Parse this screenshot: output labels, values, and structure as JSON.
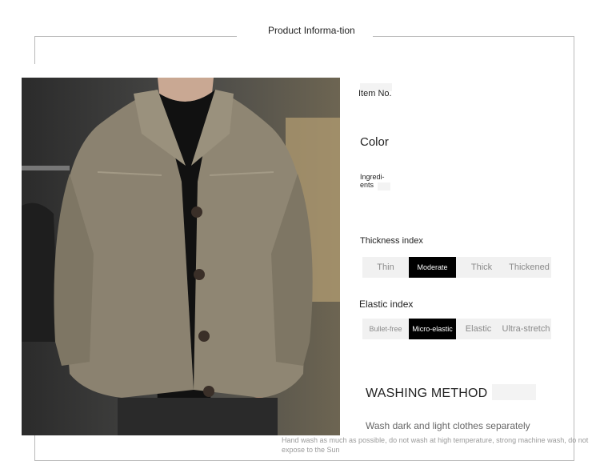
{
  "header": {
    "title": "Product Informa-tion"
  },
  "product": {
    "image_name": "fleece-jacket-photo"
  },
  "details": {
    "item_no_label": "Item No.",
    "color_label": "Color",
    "ingredients_label": "Ingredi-ents"
  },
  "thickness": {
    "label": "Thickness index",
    "options": [
      "Thin",
      "Moderate",
      "Thick",
      "Thickened"
    ],
    "selected": "Moderate"
  },
  "elasticity": {
    "label": "Elastic index",
    "options": [
      "Bullet-free",
      "Micro-elastic",
      "Elastic",
      "Ultra-stretch"
    ],
    "selected": "Micro-elastic"
  },
  "washing": {
    "title": "WASHING METHOD",
    "subtitle": "Wash dark and light clothes separately",
    "note": "Hand wash as much as possible, do not wash at high temperature, strong machine wash, do not expose to the Sun"
  },
  "colors": {
    "frame": "#b9b9b9",
    "selected_bg": "#000000",
    "option_bg": "#f1f1f1",
    "jacket": "#8b8270"
  }
}
